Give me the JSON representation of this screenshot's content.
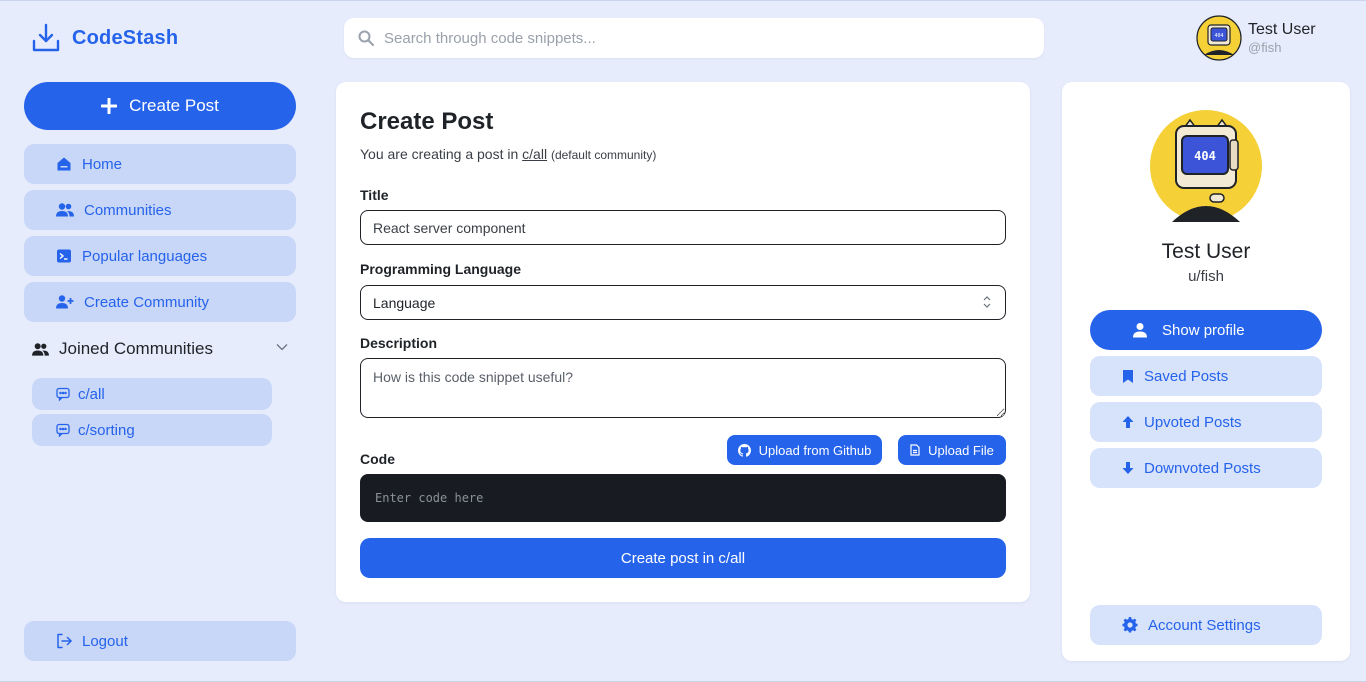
{
  "brand": {
    "name": "CodeStash",
    "accent": "#2563eb"
  },
  "search": {
    "placeholder": "Search through code snippets..."
  },
  "user": {
    "name": "Test User",
    "handle": "@fish",
    "avatar_text": "404"
  },
  "sidebar": {
    "create_post": "Create Post",
    "items": [
      {
        "label": "Home",
        "icon": "home-icon"
      },
      {
        "label": "Communities",
        "icon": "users-icon"
      },
      {
        "label": "Popular languages",
        "icon": "terminal-icon"
      },
      {
        "label": "Create Community",
        "icon": "user-plus-icon"
      }
    ],
    "joined": {
      "title": "Joined Communities",
      "items": [
        {
          "label": "c/all",
          "icon": "chat-icon"
        },
        {
          "label": "c/sorting",
          "icon": "chat-icon"
        }
      ]
    },
    "logout": "Logout"
  },
  "main": {
    "title": "Create Post",
    "subtitle_prefix": "You are creating a post in ",
    "community": "c/all",
    "default_note": "(default community)",
    "title_label": "Title",
    "title_value": "React server component",
    "language_label": "Programming Language",
    "language_value": "Language",
    "description_label": "Description",
    "description_placeholder": "How is this code snippet useful?",
    "code_label": "Code",
    "upload_github": "Upload from Github",
    "upload_file": "Upload File",
    "code_placeholder": "Enter code here",
    "submit": "Create post in c/all"
  },
  "profile": {
    "name": "Test User",
    "handle": "u/fish",
    "show_profile": "Show profile",
    "saved": "Saved Posts",
    "upvoted": "Upvoted Posts",
    "downvoted": "Downvoted Posts",
    "settings": "Account Settings"
  }
}
